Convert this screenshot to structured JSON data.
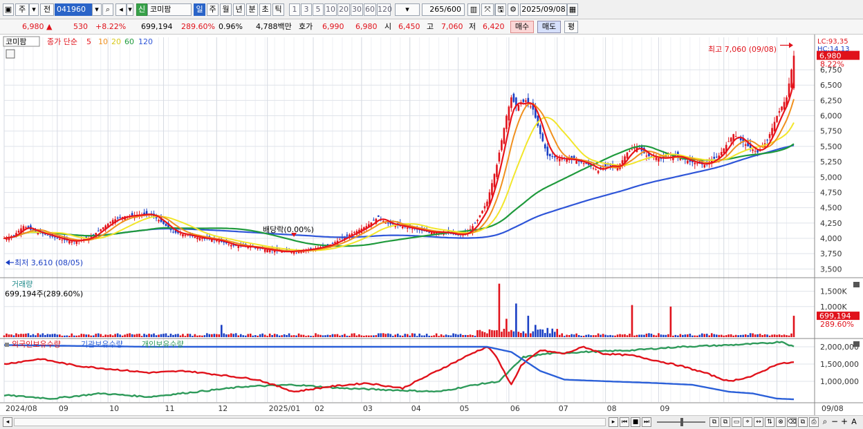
{
  "toolbar": {
    "market": "주",
    "mode": "전",
    "code": "041960",
    "badge": "신",
    "name": "코미팜",
    "periods": [
      "일",
      "주",
      "월",
      "년",
      "분",
      "초",
      "틱"
    ],
    "active_period": "일",
    "intervals": [
      "1",
      "3",
      "5",
      "10",
      "20",
      "30",
      "60",
      "120"
    ],
    "count": "265",
    "count_max": "/600",
    "date": "2025/09/08"
  },
  "quote": {
    "price": "6,980",
    "change_arrow": "▲",
    "change": "530",
    "change_pct": "+8.22%",
    "volume": "699,194",
    "volume_ratio": "289.60%",
    "turnover": "0.96%",
    "amount": "4,788백만",
    "bid_label": "호가",
    "ask": "6,990",
    "bid": "6,980",
    "open_label": "시",
    "open": "6,450",
    "high_label": "고",
    "high": "7,060",
    "low_label": "저",
    "low": "6,420",
    "buy_button": "매수",
    "sell_button": "매도",
    "avg_button": "평"
  },
  "price_panel": {
    "name_tag": "코미팜",
    "ma_label": "종가 단순",
    "ma_periods": [
      "5",
      "10",
      "20",
      "60",
      "120"
    ],
    "lc_label": "LC:93,35",
    "hc_label": "HC:14.13",
    "last_price": "6,980",
    "last_pct": "8.22%",
    "max_label": "최고 7,060 (09/08)",
    "min_label": "최저 3,610 (08/05)",
    "dividend_label": "배당락(0.00%)"
  },
  "volume_panel": {
    "title": "거래량",
    "value_label": "699,194주(289.60%)",
    "last_volume": "699,194",
    "last_ratio": "289.60%"
  },
  "holding_panel": {
    "legends": [
      "외국인보유수량",
      "기관보유수량",
      "개인보유수량"
    ]
  },
  "colors": {
    "up": "#e0121b",
    "down": "#1a3fc4",
    "ma5": "#e8141b",
    "ma10": "#f0901e",
    "ma20": "#f2e62a",
    "ma60": "#1f9a3c",
    "ma120": "#2e55d8",
    "foreign": "#e0121b",
    "institution": "#2a5fd8",
    "individual": "#2e9a5a"
  },
  "chart_data": [
    {
      "type": "candlestick",
      "panel": "price",
      "y_ticks": [
        3500,
        3750,
        4000,
        4250,
        4500,
        4750,
        5000,
        5250,
        5500,
        5750,
        6000,
        6250,
        6500,
        6750
      ],
      "y_tick_labels": [
        "3,500",
        "3,750",
        "4,000",
        "4,250",
        "4,500",
        "4,750",
        "5,000",
        "5,250",
        "5,500",
        "5,750",
        "6,000",
        "6,250",
        "6,500",
        "6,750"
      ],
      "ylim": [
        3380,
        7280
      ],
      "x_labels": [
        "2024/08",
        "09",
        "10",
        "11",
        "12",
        "2025/01",
        "02",
        "03",
        "04",
        "05",
        "06",
        "07",
        "08",
        "09",
        "09/08"
      ],
      "close_path": [
        [
          0,
          4000
        ],
        [
          4,
          4050
        ],
        [
          8,
          4200
        ],
        [
          12,
          4120
        ],
        [
          18,
          4050
        ],
        [
          24,
          3980
        ],
        [
          28,
          3950
        ],
        [
          35,
          4000
        ],
        [
          40,
          4150
        ],
        [
          45,
          4300
        ],
        [
          50,
          4360
        ],
        [
          55,
          4380
        ],
        [
          60,
          4400
        ],
        [
          64,
          4300
        ],
        [
          70,
          4100
        ],
        [
          76,
          4050
        ],
        [
          82,
          4000
        ],
        [
          88,
          3970
        ],
        [
          95,
          3880
        ],
        [
          102,
          3860
        ],
        [
          108,
          3820
        ],
        [
          115,
          3780
        ],
        [
          122,
          3800
        ],
        [
          128,
          3830
        ],
        [
          135,
          3900
        ],
        [
          140,
          4000
        ],
        [
          145,
          4100
        ],
        [
          150,
          4200
        ],
        [
          155,
          4350
        ],
        [
          158,
          4250
        ],
        [
          164,
          4200
        ],
        [
          170,
          4150
        ],
        [
          176,
          4100
        ],
        [
          182,
          4100
        ],
        [
          188,
          4050
        ],
        [
          192,
          4100
        ],
        [
          196,
          4300
        ],
        [
          200,
          4600
        ],
        [
          204,
          5200
        ],
        [
          208,
          6000
        ],
        [
          210,
          6300
        ],
        [
          212,
          6150
        ],
        [
          216,
          6250
        ],
        [
          219,
          6100
        ],
        [
          222,
          5700
        ],
        [
          225,
          5350
        ],
        [
          230,
          5300
        ],
        [
          236,
          5280
        ],
        [
          242,
          5200
        ],
        [
          246,
          5100
        ],
        [
          250,
          5200
        ],
        [
          254,
          5150
        ],
        [
          258,
          5400
        ],
        [
          262,
          5500
        ],
        [
          266,
          5350
        ],
        [
          272,
          5300
        ],
        [
          278,
          5350
        ],
        [
          284,
          5250
        ],
        [
          290,
          5200
        ],
        [
          296,
          5350
        ],
        [
          302,
          5700
        ],
        [
          308,
          5500
        ],
        [
          312,
          5400
        ],
        [
          316,
          5600
        ],
        [
          320,
          6000
        ],
        [
          324,
          6300
        ],
        [
          327,
          6980
        ]
      ],
      "min": {
        "date": "08/05",
        "value": 3610
      },
      "max": {
        "date": "09/08",
        "value": 7060
      },
      "series": [
        {
          "name": "5"
        },
        {
          "name": "10"
        },
        {
          "name": "20"
        },
        {
          "name": "60"
        },
        {
          "name": "120"
        }
      ]
    },
    {
      "type": "bar",
      "panel": "volume",
      "title": "거래량",
      "y_ticks": [
        1000000,
        1500000
      ],
      "y_tick_labels": [
        "1,000K",
        "1,500K"
      ],
      "ylim": [
        0,
        1900000
      ],
      "spikes": [
        [
          90,
          400000
        ],
        [
          205,
          1750000
        ],
        [
          208,
          600000
        ],
        [
          212,
          1100000
        ],
        [
          217,
          700000
        ],
        [
          220,
          400000
        ],
        [
          225,
          300000
        ],
        [
          260,
          1050000
        ],
        [
          276,
          1000000
        ],
        [
          327,
          699194
        ]
      ]
    },
    {
      "type": "line",
      "panel": "holding",
      "y_ticks": [
        1000000,
        1500000,
        2000000
      ],
      "y_tick_labels": [
        "1,000,000",
        "1,500,000",
        "2,000,000"
      ],
      "ylim": [
        400000,
        2200000
      ],
      "series": [
        {
          "name": "외국인보유수량",
          "values": [
            [
              0,
              1500000
            ],
            [
              15,
              1650000
            ],
            [
              30,
              1450000
            ],
            [
              45,
              1350000
            ],
            [
              60,
              1250000
            ],
            [
              75,
              1300000
            ],
            [
              90,
              1180000
            ],
            [
              105,
              1050000
            ],
            [
              120,
              700000
            ],
            [
              135,
              850000
            ],
            [
              150,
              950000
            ],
            [
              165,
              800000
            ],
            [
              175,
              1150000
            ],
            [
              185,
              1500000
            ],
            [
              195,
              1850000
            ],
            [
              200,
              2000000
            ],
            [
              203,
              1800000
            ],
            [
              210,
              900000
            ],
            [
              214,
              1450000
            ],
            [
              222,
              1900000
            ],
            [
              232,
              1800000
            ],
            [
              240,
              2000000
            ],
            [
              248,
              1800000
            ],
            [
              260,
              1750000
            ],
            [
              270,
              1600000
            ],
            [
              280,
              1450000
            ],
            [
              290,
              1250000
            ],
            [
              300,
              1000000
            ],
            [
              310,
              1150000
            ],
            [
              320,
              1500000
            ],
            [
              327,
              1550000
            ]
          ]
        },
        {
          "name": "기관보유수량",
          "values": [
            [
              0,
              2050000
            ],
            [
              60,
              2000000
            ],
            [
              120,
              2000000
            ],
            [
              190,
              2000000
            ],
            [
              200,
              2000000
            ],
            [
              210,
              1850000
            ],
            [
              222,
              1300000
            ],
            [
              232,
              1050000
            ],
            [
              250,
              1000000
            ],
            [
              270,
              950000
            ],
            [
              285,
              900000
            ],
            [
              300,
              700000
            ],
            [
              310,
              650000
            ],
            [
              320,
              500000
            ],
            [
              327,
              480000
            ]
          ]
        },
        {
          "name": "개인보유수량",
          "values": [
            [
              0,
              600000
            ],
            [
              20,
              500000
            ],
            [
              40,
              650000
            ],
            [
              60,
              550000
            ],
            [
              80,
              700000
            ],
            [
              100,
              850000
            ],
            [
              120,
              900000
            ],
            [
              140,
              800000
            ],
            [
              160,
              750000
            ],
            [
              180,
              700000
            ],
            [
              195,
              900000
            ],
            [
              205,
              1000000
            ],
            [
              215,
              1700000
            ],
            [
              225,
              1800000
            ],
            [
              240,
              1850000
            ],
            [
              260,
              1900000
            ],
            [
              280,
              2000000
            ],
            [
              300,
              2050000
            ],
            [
              315,
              2100000
            ],
            [
              322,
              2150000
            ],
            [
              327,
              2000000
            ]
          ]
        }
      ]
    }
  ]
}
